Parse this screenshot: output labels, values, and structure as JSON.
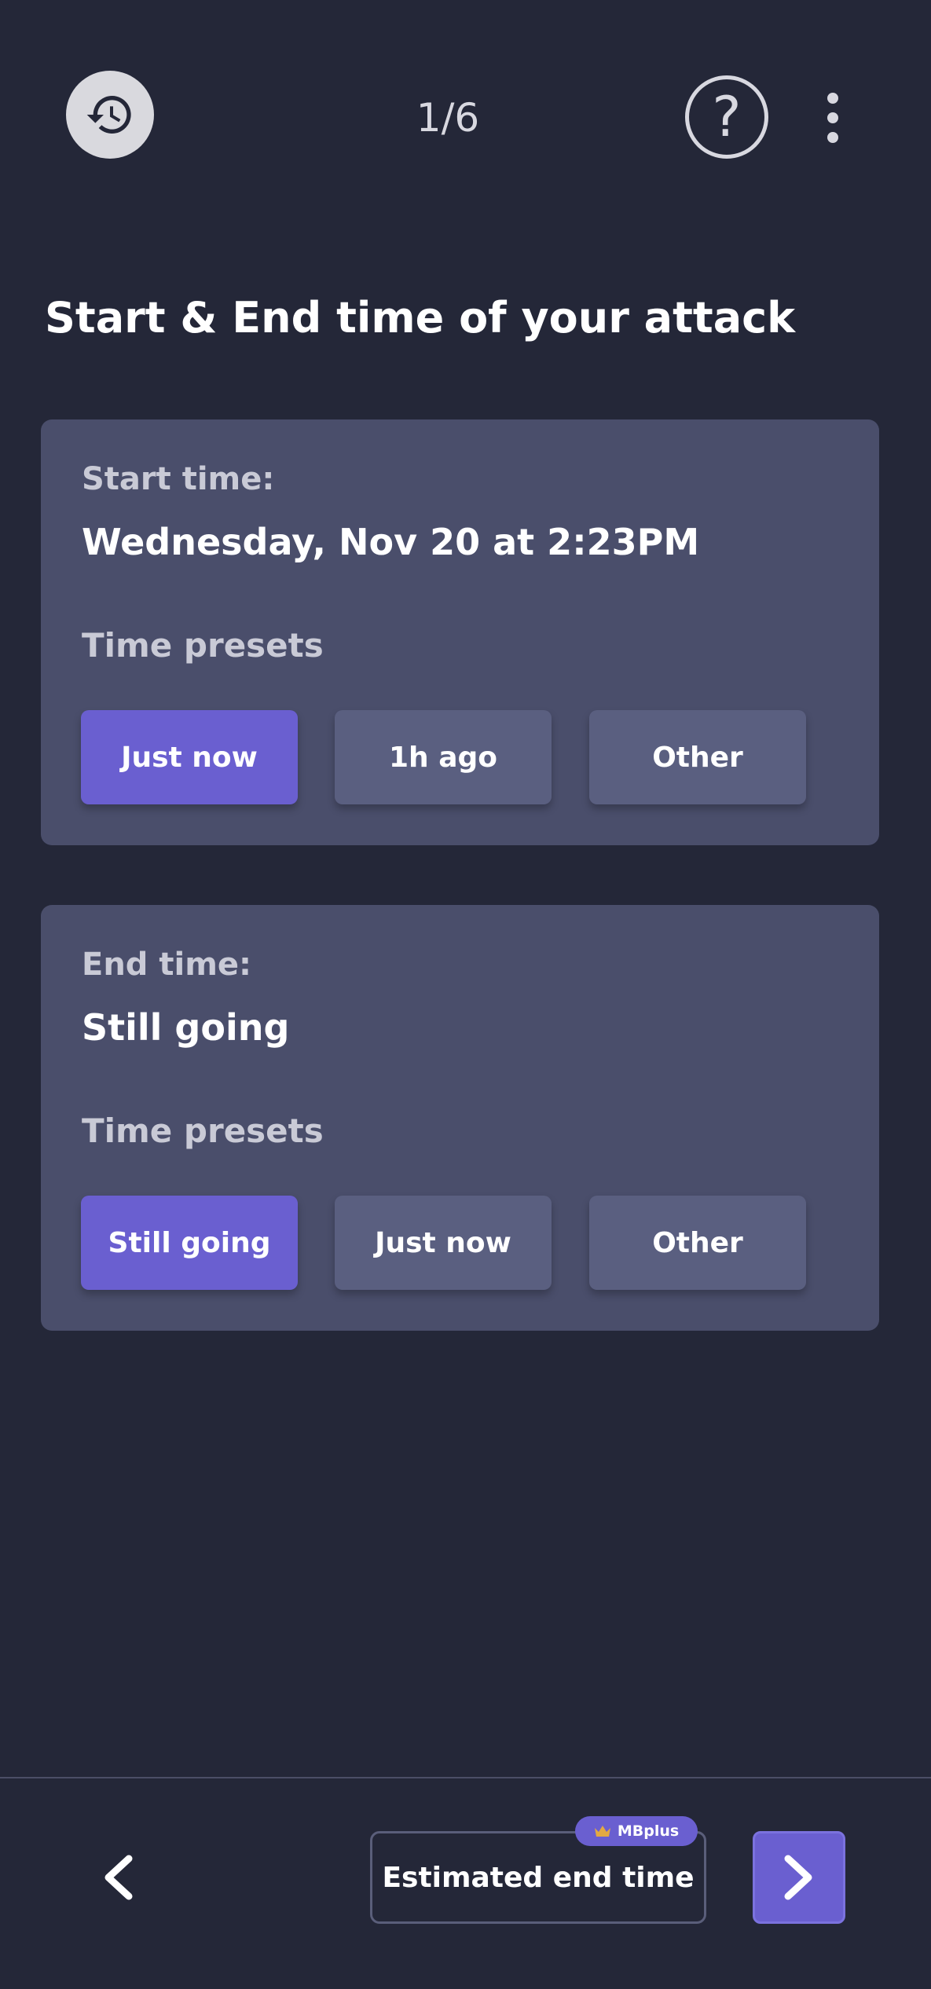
{
  "header": {
    "history_icon": "history-icon",
    "step_counter": "1/6",
    "help_icon": "help-circle-icon",
    "help_glyph": "?",
    "more_icon": "more-vertical-icon"
  },
  "page_title": "Start & End time of your attack",
  "start_card": {
    "label": "Start time:",
    "value": "Wednesday, Nov 20 at 2:23PM",
    "presets_label": "Time presets",
    "presets": [
      {
        "label": "Just now",
        "selected": true
      },
      {
        "label": "1h ago",
        "selected": false
      },
      {
        "label": "Other",
        "selected": false
      }
    ]
  },
  "end_card": {
    "label": "End time:",
    "value": "Still going",
    "presets_label": "Time presets",
    "presets": [
      {
        "label": "Still going",
        "selected": true
      },
      {
        "label": "Just now",
        "selected": false
      },
      {
        "label": "Other",
        "selected": false
      }
    ]
  },
  "footer": {
    "back_icon": "chevron-left-icon",
    "estimate_label": "Estimated end time",
    "badge_label": "MBplus",
    "badge_icon": "crown-icon",
    "next_icon": "chevron-right-icon"
  },
  "colors": {
    "background": "#242738",
    "card": "#4a4e6b",
    "button": "#5a5f80",
    "accent": "#6a5fd0",
    "crown": "#e3a942"
  }
}
